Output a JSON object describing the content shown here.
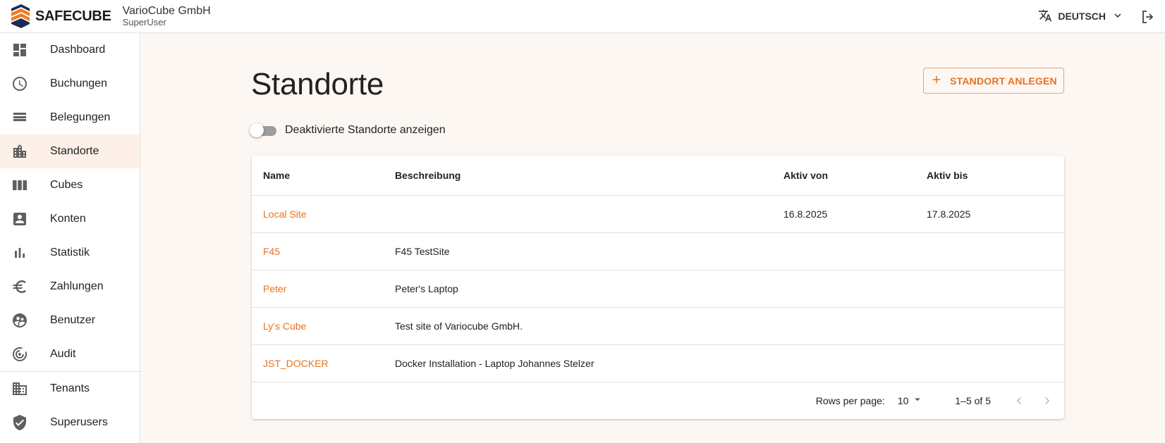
{
  "header": {
    "brand": "SAFECUBE",
    "company": "VarioCube GmbH",
    "role": "SuperUser",
    "language": "DEUTSCH"
  },
  "sidebar": {
    "items": [
      {
        "label": "Dashboard",
        "icon": "dashboard-icon"
      },
      {
        "label": "Buchungen",
        "icon": "clock-icon"
      },
      {
        "label": "Belegungen",
        "icon": "view-stream-icon"
      },
      {
        "label": "Standorte",
        "icon": "location-city-icon",
        "active": true
      },
      {
        "label": "Cubes",
        "icon": "view-week-icon"
      },
      {
        "label": "Konten",
        "icon": "account-box-icon"
      },
      {
        "label": "Statistik",
        "icon": "bar-chart-icon"
      },
      {
        "label": "Zahlungen",
        "icon": "euro-icon"
      },
      {
        "label": "Benutzer",
        "icon": "group-icon"
      },
      {
        "label": "Audit",
        "icon": "radar-icon"
      }
    ],
    "admin_items": [
      {
        "label": "Tenants",
        "icon": "building-icon"
      },
      {
        "label": "Superusers",
        "icon": "verified-shield-icon"
      }
    ]
  },
  "main": {
    "title": "Standorte",
    "add_button": "STANDORT ANLEGEN",
    "toggle_label": "Deaktivierte Standorte anzeigen",
    "toggle_on": false
  },
  "table": {
    "columns": [
      "Name",
      "Beschreibung",
      "Aktiv von",
      "Aktiv bis"
    ],
    "rows": [
      {
        "name": "Local Site",
        "description": "",
        "active_from": "16.8.2025",
        "active_to": "17.8.2025"
      },
      {
        "name": "F45",
        "description": "F45 TestSite",
        "active_from": "",
        "active_to": ""
      },
      {
        "name": "Peter",
        "description": "Peter's Laptop",
        "active_from": "",
        "active_to": ""
      },
      {
        "name": "Ly's Cube",
        "description": "Test site of Variocube GmbH.",
        "active_from": "",
        "active_to": ""
      },
      {
        "name": "JST_DOCKER",
        "description": "Docker Installation - Laptop Johannes Stelzer",
        "active_from": "",
        "active_to": ""
      }
    ],
    "pagination": {
      "rows_per_page_label": "Rows per page:",
      "rows_per_page": "10",
      "range": "1–5 of 5"
    }
  },
  "colors": {
    "accent": "#e8711c",
    "logo_orange": "#f07c22",
    "logo_navy": "#1d2a55",
    "page_bg": "#fdf7f3",
    "active_nav_bg": "#fdf0e8"
  }
}
